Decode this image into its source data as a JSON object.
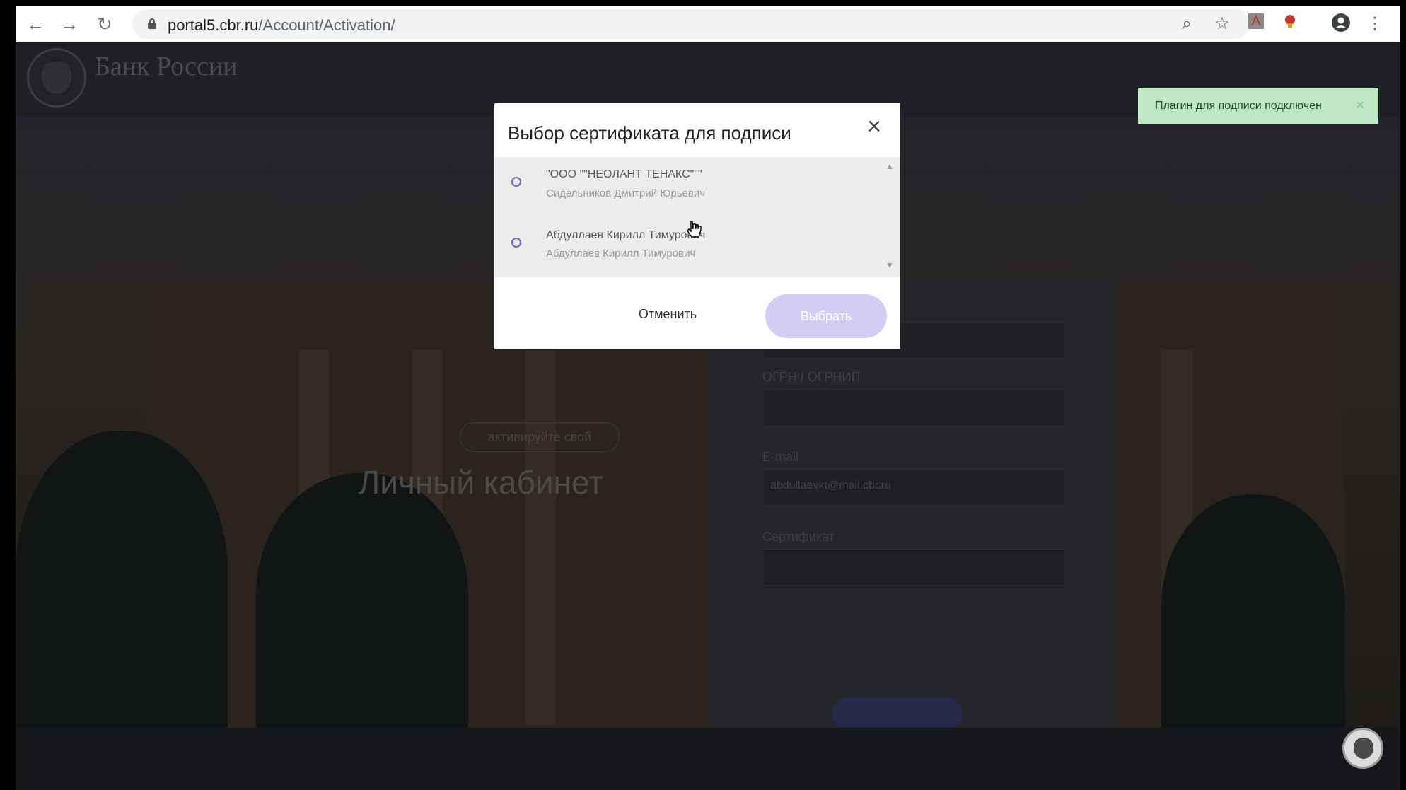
{
  "browser": {
    "url_host": "portal5.cbr.ru",
    "url_path": "/Account/Activation/",
    "icons": [
      "back-icon",
      "forward-icon",
      "reload-icon",
      "lock-icon",
      "zoom-icon",
      "star-icon",
      "pdf-extension-icon",
      "extension-icon",
      "profile-icon",
      "menu-icon"
    ]
  },
  "header": {
    "logo_text": "Банк России"
  },
  "hero": {
    "pill": "активируйте свой",
    "title": "Личный кабинет"
  },
  "form": {
    "ogrn_label": "ОГРН / ОГРНИП",
    "email_label": "E-mail",
    "email_value": "abdullaevkt@mail.cbr.ru",
    "certificate_label": "Сертификат"
  },
  "toast": {
    "text": "Плагин для подписи подключен",
    "close": "×",
    "color": "#bfe7c4"
  },
  "modal": {
    "title": "Выбор сертификата для подписи",
    "close": "×",
    "certificates": [
      {
        "name": "\"ООО \"\"НЕОЛАНТ ТЕНАКС\"\"\"",
        "owner": "Сидельников Дмитрий Юрьевич"
      },
      {
        "name": "Абдуллаев Кирилл Тимурович",
        "owner": "Абдуллаев Кирилл Тимурович"
      }
    ],
    "cancel_label": "Отменить",
    "select_label": "Выбрать",
    "accent_color": "#6f61d1"
  }
}
